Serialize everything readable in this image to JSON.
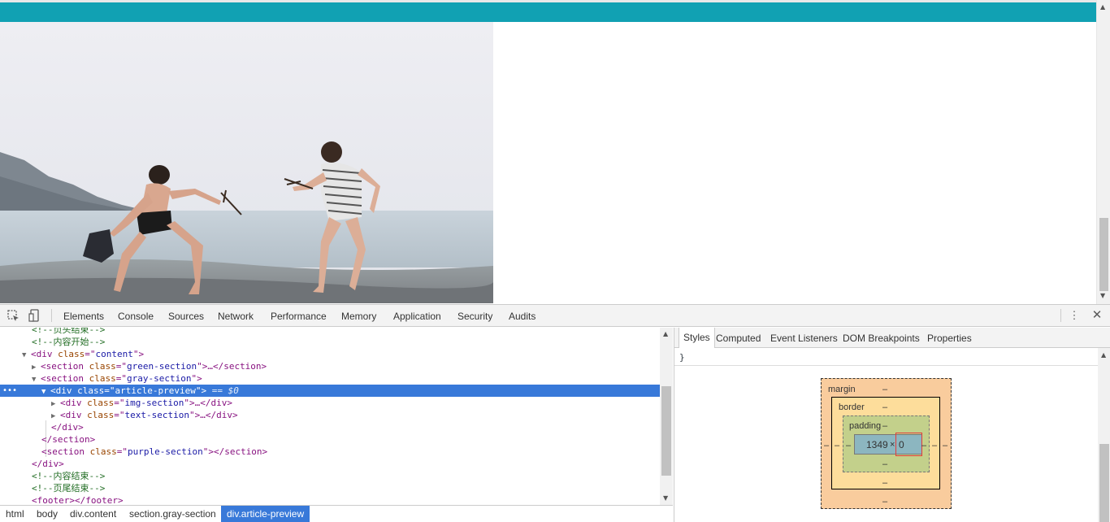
{
  "page": {
    "topbar_color": "#11a1b3"
  },
  "toolbar": {
    "tabs": [
      "Elements",
      "Console",
      "Sources",
      "Network",
      "Performance",
      "Memory",
      "Application",
      "Security",
      "Audits"
    ],
    "icons": [
      "inspect-element-icon",
      "device-toolbar-icon",
      "more-options-icon",
      "close-icon"
    ]
  },
  "dom_tree": {
    "l0": "<!--页头结束-->",
    "l1": "<!--内容开始-->",
    "l2_tag": "div",
    "l2_attr": "class",
    "l2_val": "content",
    "l3_tag": "section",
    "l3_attr": "class",
    "l3_val": "green-section",
    "l3_end": "…</section>",
    "l4_tag": "section",
    "l4_attr": "class",
    "l4_val": "gray-section",
    "l5_tag": "div",
    "l5_attr": "class",
    "l5_val": "article-preview",
    "l5_marker": " == $0",
    "l6_tag": "div",
    "l6_attr": "class",
    "l6_val": "img-section",
    "l6_end": "…</div>",
    "l7_tag": "div",
    "l7_attr": "class",
    "l7_val": "text-section",
    "l7_end": "…</div>",
    "l8": "</div>",
    "l9": "</section>",
    "l10_tag": "section",
    "l10_attr": "class",
    "l10_val": "purple-section",
    "l10_end": "</section>",
    "l11": "</div>",
    "l12": "<!--内容结束-->",
    "l13": "<!--页尾结束-->",
    "l14": "<footer></footer>"
  },
  "breadcrumbs": [
    "html",
    "body",
    "div.content",
    "section.gray-section",
    "div.article-preview"
  ],
  "sidebar": {
    "tabs": [
      "Styles",
      "Computed",
      "Event Listeners",
      "DOM Breakpoints",
      "Properties"
    ],
    "closing_brace": "}"
  },
  "box_model": {
    "margin_label": "margin",
    "border_label": "border",
    "padding_label": "padding",
    "dash": "–",
    "content_width": "1349",
    "times": "×",
    "content_height": "0"
  }
}
